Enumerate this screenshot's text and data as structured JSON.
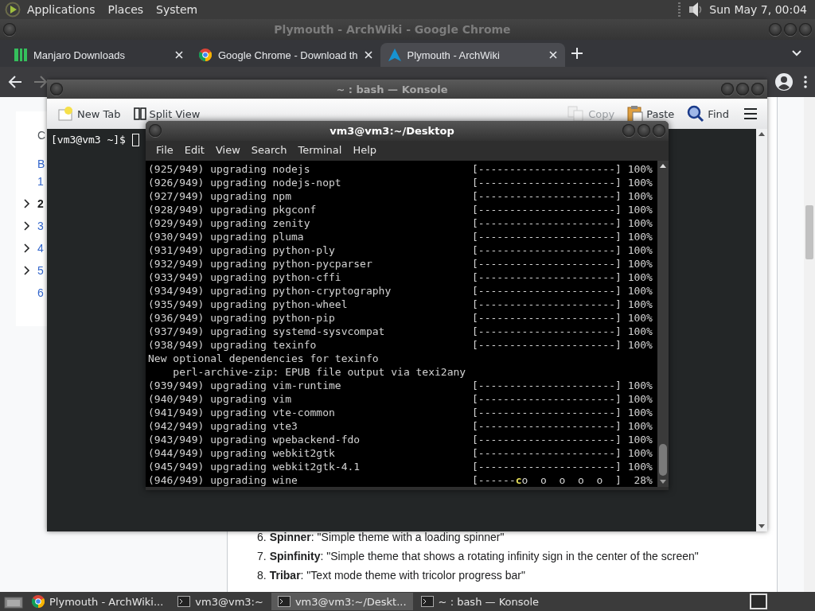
{
  "top_panel": {
    "menus": [
      "Applications",
      "Places",
      "System"
    ],
    "clock": "Sun May 7, 00:04"
  },
  "browser": {
    "title": "Plymouth - ArchWiki - Google Chrome",
    "tabs": [
      {
        "label": "Manjaro Downloads",
        "kind": "blocks",
        "selected": false
      },
      {
        "label": "Google Chrome - Download th",
        "kind": "ring",
        "selected": false
      },
      {
        "label": "Plymouth - ArchWiki",
        "kind": "triangle",
        "selected": true
      }
    ],
    "sidebar": {
      "heading": "C",
      "items": [
        {
          "label": "B",
          "expandable": false,
          "selected": false
        },
        {
          "label": "1",
          "expandable": false,
          "selected": false
        },
        {
          "label": "2",
          "expandable": true,
          "selected": true
        },
        {
          "label": "3",
          "expandable": true,
          "selected": false
        },
        {
          "label": "4",
          "expandable": true,
          "selected": false
        },
        {
          "label": "5",
          "expandable": true,
          "selected": false
        },
        {
          "label": "6",
          "expandable": false,
          "selected": false
        }
      ]
    },
    "article_items": [
      {
        "number": "6.",
        "text": "**Spinner**: \"Simple theme with a loading spinner\""
      },
      {
        "number": "7.",
        "text": "**Spinfinity**: \"Simple theme that shows a rotating infinity sign in the center of the screen\""
      },
      {
        "number": "8.",
        "text": "**Tribar**: \"Text mode theme with tricolor progress bar\""
      }
    ]
  },
  "konsole": {
    "title": "~ : bash — Konsole",
    "toolbar": [
      {
        "label": "New Tab",
        "kind": "new-tab",
        "disabled": false
      },
      {
        "label": "Split View",
        "kind": "split-view",
        "disabled": false
      },
      {
        "label": "Copy",
        "kind": "copy",
        "disabled": true
      },
      {
        "label": "Paste",
        "kind": "paste",
        "disabled": false
      },
      {
        "label": "Find",
        "kind": "find",
        "disabled": false
      }
    ],
    "prompt": "[vm3@vm3 ~]$"
  },
  "terminal": {
    "title": "vm3@vm3:~/Desktop",
    "menus": [
      "File",
      "Edit",
      "View",
      "Search",
      "Terminal",
      "Help"
    ],
    "lines": [
      {
        "kind": "progress",
        "text": "(925/949) upgrading nodejs",
        "bar": "[----------------------]",
        "percent": "100%"
      },
      {
        "kind": "progress",
        "text": "(926/949) upgrading nodejs-nopt",
        "bar": "[----------------------]",
        "percent": "100%"
      },
      {
        "kind": "progress",
        "text": "(927/949) upgrading npm",
        "bar": "[----------------------]",
        "percent": "100%"
      },
      {
        "kind": "progress",
        "text": "(928/949) upgrading pkgconf",
        "bar": "[----------------------]",
        "percent": "100%"
      },
      {
        "kind": "progress",
        "text": "(929/949) upgrading zenity",
        "bar": "[----------------------]",
        "percent": "100%"
      },
      {
        "kind": "progress",
        "text": "(930/949) upgrading pluma",
        "bar": "[----------------------]",
        "percent": "100%"
      },
      {
        "kind": "progress",
        "text": "(931/949) upgrading python-ply",
        "bar": "[----------------------]",
        "percent": "100%"
      },
      {
        "kind": "progress",
        "text": "(932/949) upgrading python-pycparser",
        "bar": "[----------------------]",
        "percent": "100%"
      },
      {
        "kind": "progress",
        "text": "(933/949) upgrading python-cffi",
        "bar": "[----------------------]",
        "percent": "100%"
      },
      {
        "kind": "progress",
        "text": "(934/949) upgrading python-cryptography",
        "bar": "[----------------------]",
        "percent": "100%"
      },
      {
        "kind": "progress",
        "text": "(935/949) upgrading python-wheel",
        "bar": "[----------------------]",
        "percent": "100%"
      },
      {
        "kind": "progress",
        "text": "(936/949) upgrading python-pip",
        "bar": "[----------------------]",
        "percent": "100%"
      },
      {
        "kind": "progress",
        "text": "(937/949) upgrading systemd-sysvcompat",
        "bar": "[----------------------]",
        "percent": "100%"
      },
      {
        "kind": "progress",
        "text": "(938/949) upgrading texinfo",
        "bar": "[----------------------]",
        "percent": "100%"
      },
      {
        "kind": "text",
        "text": "New optional dependencies for texinfo"
      },
      {
        "kind": "text",
        "text": "    perl-archive-zip: EPUB file output via texi2any"
      },
      {
        "kind": "progress",
        "text": "(939/949) upgrading vim-runtime",
        "bar": "[----------------------]",
        "percent": "100%"
      },
      {
        "kind": "progress",
        "text": "(940/949) upgrading vim",
        "bar": "[----------------------]",
        "percent": "100%"
      },
      {
        "kind": "progress",
        "text": "(941/949) upgrading vte-common",
        "bar": "[----------------------]",
        "percent": "100%"
      },
      {
        "kind": "progress",
        "text": "(942/949) upgrading vte3",
        "bar": "[----------------------]",
        "percent": "100%"
      },
      {
        "kind": "progress",
        "text": "(943/949) upgrading wpebackend-fdo",
        "bar": "[----------------------]",
        "percent": "100%"
      },
      {
        "kind": "progress",
        "text": "(944/949) upgrading webkit2gtk",
        "bar": "[----------------------]",
        "percent": "100%"
      },
      {
        "kind": "progress",
        "text": "(945/949) upgrading webkit2gtk-4.1",
        "bar": "[----------------------]",
        "percent": "100%"
      },
      {
        "kind": "progress",
        "text": "(946/949) upgrading wine",
        "bar": "[------**c**o  o  o  o  o  ]",
        "percent": "28%"
      }
    ]
  },
  "taskbar": {
    "items": [
      {
        "label": "Plymouth - ArchWiki...",
        "kind": "browser",
        "selected": false
      },
      {
        "label": "vm3@vm3:~",
        "kind": "terminal",
        "selected": false
      },
      {
        "label": "vm3@vm3:~/Deskt...",
        "kind": "terminal",
        "selected": true
      },
      {
        "label": "~ : bash — Konsole",
        "kind": "terminal",
        "selected": false
      }
    ]
  }
}
